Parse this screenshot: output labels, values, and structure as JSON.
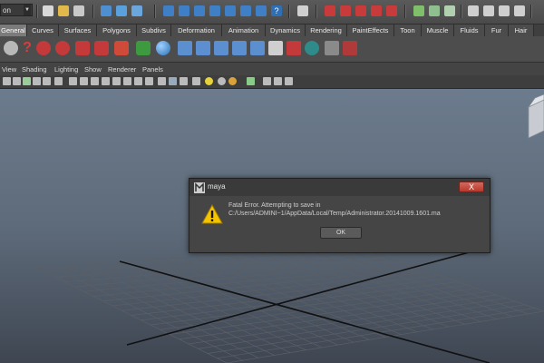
{
  "statusline": {
    "mode_value": "on",
    "icons": [
      "new-scene-icon",
      "open-scene-icon",
      "save-scene-icon",
      "select-hierarchy-icon",
      "select-object-icon",
      "select-component-icon",
      "move-tool-icon",
      "rotate-tool-icon",
      "scale-tool-icon",
      "snap-grid-icon",
      "snap-curve-icon",
      "snap-point-icon",
      "help-icon",
      "history-icon",
      "render-frame-icon",
      "ipr-render-icon",
      "render-settings-icon",
      "hypershade-icon",
      "attribute-editor-icon",
      "channel-box-icon",
      "tool-settings-icon",
      "layer-editor-icon",
      "outliner-icon"
    ]
  },
  "shelf_tabs": [
    "General",
    "Curves",
    "Surfaces",
    "Polygons",
    "Subdivs",
    "Deformation",
    "Animation",
    "Dynamics",
    "Rendering",
    "PaintEffects",
    "Toon",
    "Muscle",
    "Fluids",
    "Fur",
    "Hair"
  ],
  "shelf_active_tab": "General",
  "shelf_icons": [
    "mel-command-icon",
    "help-line-icon",
    "hotbox-icon",
    "render-view-icon",
    "paint-tool-icon",
    "select-lasso-icon",
    "create-sphere-icon",
    "create-joint-icon",
    "ik-handle-icon",
    "skin-bind-icon",
    "skin-paint-icon",
    "constraint-icon",
    "graph-editor-icon",
    "shading-node-icon",
    "render-sphere-icon",
    "particle-icon"
  ],
  "panel_menu": [
    "View",
    "Shading",
    "Lighting",
    "Show",
    "Renderer",
    "Panels"
  ],
  "dialog": {
    "title": "maya",
    "close_label": "X",
    "message_line1": "Fatal Error. Attempting to save in",
    "message_line2": "C:/Users/ADMINI~1/AppData/Local/Temp/Administrator.20141009.1601.ma",
    "ok_label": "OK"
  },
  "colors": {
    "warning_yellow": "#f4c400",
    "close_red": "#c0463a",
    "viewport_top": "#6c7b8d",
    "viewport_bottom": "#3f4652"
  }
}
